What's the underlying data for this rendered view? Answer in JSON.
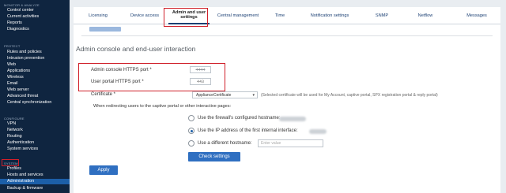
{
  "sidebar": {
    "sections": [
      {
        "heading": "MONITOR & ANALYZE",
        "items": [
          "Control center",
          "Current activities",
          "Reports",
          "Diagnostics"
        ]
      },
      {
        "heading": "PROTECT",
        "items": [
          "Rules and policies",
          "Intrusion prevention",
          "Web",
          "Applications",
          "Wireless",
          "Email",
          "Web server",
          "Advanced threat",
          "Central synchronization"
        ]
      },
      {
        "heading": "CONFIGURE",
        "items": [
          "VPN",
          "Network",
          "Routing",
          "Authentication",
          "System services"
        ]
      },
      {
        "heading": "SYSTEM",
        "items": [
          "Profiles",
          "Hosts and services",
          "Administration",
          "Backup & firmware"
        ]
      }
    ]
  },
  "tabs": [
    "Licensing",
    "Device access",
    "Admin and user settings",
    "Central management",
    "Time",
    "Notification settings",
    "SNMP",
    "Netflow",
    "Messages"
  ],
  "active_tab": "Admin and user settings",
  "section": {
    "title": "Admin console and end-user interaction",
    "admin_port_label": "Admin console HTTPS port *",
    "admin_port_value": "4444",
    "user_port_label": "User portal HTTPS port *",
    "user_port_value": "443",
    "certificate_label": "Certificate *",
    "certificate_value": "ApplianceCertificate",
    "certificate_note": "(Selected certificate will be used for My Account, captive portal, SPX registration portal & reply portal)",
    "redirect_text": "When redirecting users to the captive portal or other interactive pages:",
    "radio_1": "Use the firewall's configured hostname:",
    "radio_2": "Use the IP address of the first internal interface:",
    "radio_3": "Use a different hostname:",
    "hostname_placeholder": "Enter value",
    "selected_radio": 2,
    "check_settings": "Check settings",
    "apply": "Apply"
  },
  "colors": {
    "sidebar_bg": "#0f2540",
    "active_nav": "#1c5fa8",
    "button": "#2f6fc1",
    "highlight": "#d0202a"
  }
}
